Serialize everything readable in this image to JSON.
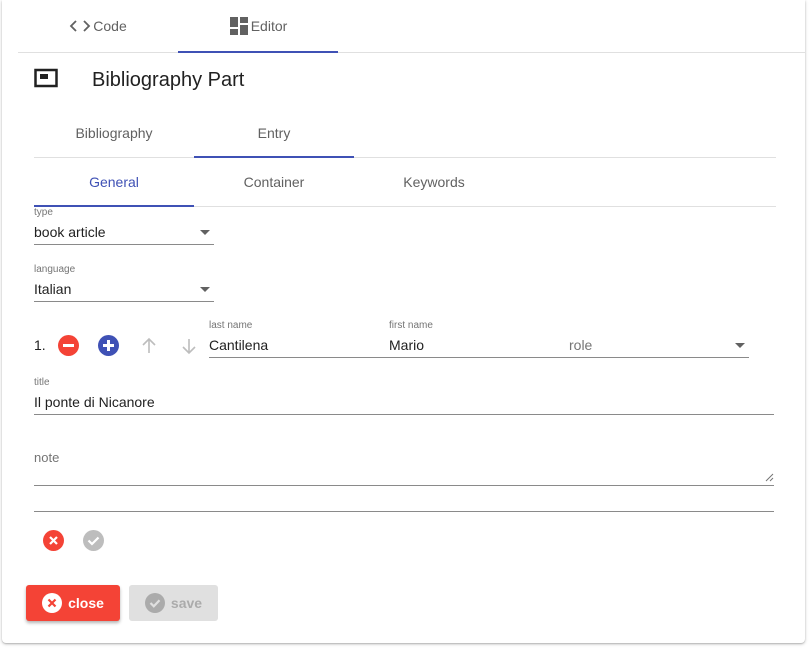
{
  "top_tabs": [
    {
      "label": "Code",
      "icon": "code-icon"
    },
    {
      "label": "Editor",
      "icon": "dashboard-icon"
    }
  ],
  "header": {
    "title": "Bibliography Part",
    "icon": "featured-video-icon"
  },
  "main_tabs": [
    {
      "label": "Bibliography"
    },
    {
      "label": "Entry"
    }
  ],
  "sub_tabs": [
    {
      "label": "General"
    },
    {
      "label": "Container"
    },
    {
      "label": "Keywords"
    }
  ],
  "form": {
    "type": {
      "label": "type",
      "value": "book article"
    },
    "language": {
      "label": "language",
      "value": "Italian"
    },
    "authors": [
      {
        "ordinal": "1.",
        "last_name_label": "last name",
        "last_name": "Cantilena",
        "first_name_label": "first name",
        "first_name": "Mario",
        "role_placeholder": "role"
      }
    ],
    "title": {
      "label": "title",
      "value": "Il ponte di Nicanore"
    },
    "note": {
      "placeholder": "note"
    }
  },
  "actions": {
    "close_label": "close",
    "save_label": "save"
  },
  "colors": {
    "accent": "#3f51b5",
    "danger": "#f44336",
    "disabled": "#e0e0e0",
    "check": "#9e9e9e"
  }
}
